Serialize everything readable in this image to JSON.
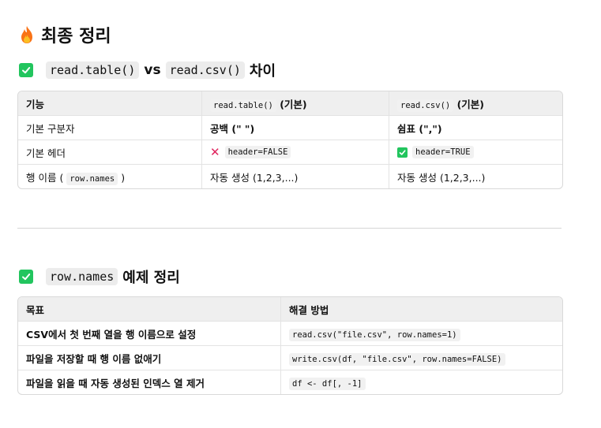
{
  "heading": {
    "icon": "fire-icon",
    "title": "최종 정리"
  },
  "section1": {
    "icon": "check-box-icon",
    "code_a": "read.table()",
    "vs": "vs",
    "code_b": "read.csv()",
    "suffix": "차이",
    "table": {
      "headers": {
        "col1": "기능",
        "col2_code": "read.table()",
        "col2_suffix": "(기본)",
        "col3_code": "read.csv()",
        "col3_suffix": "(기본)"
      },
      "rows": [
        {
          "feature": "기본 구분자",
          "table_val": "공백 (\" \")",
          "csv_val": "쉼표 (\",\")"
        },
        {
          "feature": "기본 헤더",
          "table_icon": "cross-mark-icon",
          "table_val": "header=FALSE",
          "csv_icon": "check-box-icon",
          "csv_val": "header=TRUE"
        },
        {
          "feature_prefix": "행 이름 (",
          "feature_code": "row.names",
          "feature_suffix": ")",
          "table_val": "자동 생성 (1,2,3,...)",
          "csv_val": "자동 생성 (1,2,3,...)"
        }
      ]
    }
  },
  "section2": {
    "icon": "check-box-icon",
    "code": "row.names",
    "suffix": "예제 정리",
    "table": {
      "headers": {
        "goal": "목표",
        "solution": "해결 방법"
      },
      "rows": [
        {
          "goal": "CSV에서 첫 번째 열을 행 이름으로 설정",
          "code": "read.csv(\"file.csv\", row.names=1)"
        },
        {
          "goal": "파일을 저장할 때 행 이름 없애기",
          "code": "write.csv(df, \"file.csv\", row.names=FALSE)"
        },
        {
          "goal": "파일을 읽을 때 자동 생성된 인덱스 열 제거",
          "code": "df <- df[, -1]"
        }
      ]
    }
  },
  "colors": {
    "check_green": "#22c55e",
    "cross_red": "#e0245e",
    "fire_orange": "#f97316"
  }
}
